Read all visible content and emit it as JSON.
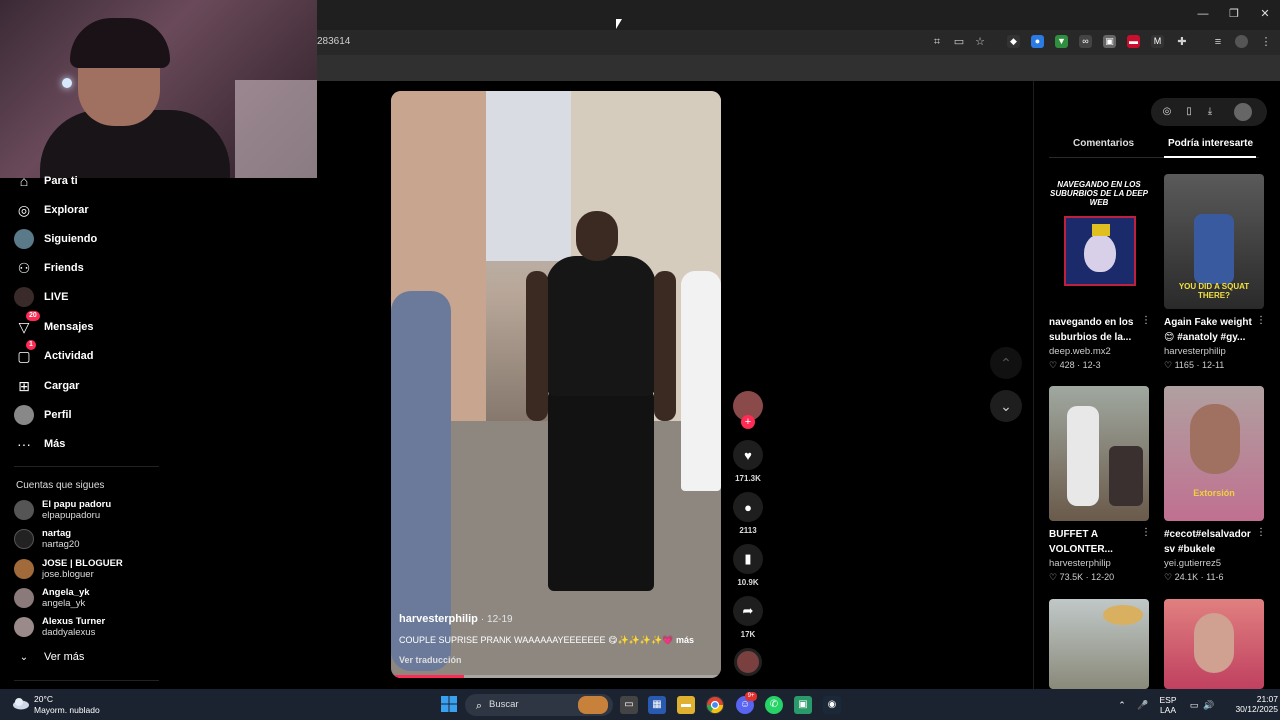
{
  "browser": {
    "url_fragment": "283614",
    "window_controls": [
      "—",
      "❐",
      "✕"
    ]
  },
  "sidebar": {
    "partial_item": "Para ti",
    "items": [
      {
        "label": "Explorar",
        "icon": "compass-icon"
      },
      {
        "label": "Siguiendo",
        "icon": "following-avatar-icon"
      },
      {
        "label": "Friends",
        "icon": "friends-icon"
      },
      {
        "label": "LIVE",
        "icon": "live-icon"
      },
      {
        "label": "Mensajes",
        "icon": "messages-icon",
        "badge": "20"
      },
      {
        "label": "Actividad",
        "icon": "activity-icon",
        "badge": "1"
      },
      {
        "label": "Cargar",
        "icon": "upload-icon"
      },
      {
        "label": "Perfil",
        "icon": "profile-avatar-icon"
      },
      {
        "label": "Más",
        "icon": "more-dots-icon"
      }
    ],
    "following_title": "Cuentas que sigues",
    "following": [
      {
        "name": "El papu padoru",
        "handle": "elpapupadoru"
      },
      {
        "name": "nartag",
        "handle": "nartag20"
      },
      {
        "name": "JOSE | BLOGUER",
        "handle": "jose.bloguer"
      },
      {
        "name": "Angela_yk",
        "handle": "angela_yk"
      },
      {
        "name": "Alexus Turner",
        "handle": "daddyalexus"
      }
    ],
    "see_more": "Ver más"
  },
  "video": {
    "author": "harvesterphilip",
    "date": "· 12-19",
    "description": "COUPLE SUPRISE PRANK WAAAAAAYEEEEEEE 😋✨✨✨✨💗",
    "more": "más",
    "translate": "Ver traducción",
    "progress": 0.22
  },
  "actions": {
    "likes": "171.3K",
    "comments": "2113",
    "saves": "10.9K",
    "shares": "17K"
  },
  "right_panel": {
    "tabs": [
      "Comentarios",
      "Podría interesarte"
    ],
    "active_tab": 1,
    "cards": [
      {
        "title": "navegando en los suburbios de la...",
        "author": "deep.web.mx2",
        "likes": "428",
        "date": "12-3",
        "thumb_text": "NAVEGANDO EN LOS SUBURBIOS DE LA DEEP WEB"
      },
      {
        "title": "Again Fake weight 😊 #anatoly #gy...",
        "author": "harvesterphilip",
        "likes": "1165",
        "date": "12-11",
        "thumb_text": "YOU DID A SQUAT THERE?"
      },
      {
        "title": "BUFFET A VOLONTER...",
        "author": "harvesterphilip",
        "likes": "73.5K",
        "date": "12-20",
        "thumb_text": ""
      },
      {
        "title": "#cecot#elsalvador sv #bukele",
        "author": "yei.gutierrez5",
        "likes": "24.1K",
        "date": "11-6",
        "thumb_text": "Extorsión"
      },
      {
        "title": "",
        "author": "",
        "likes": "",
        "date": "",
        "thumb_text": ""
      },
      {
        "title": "",
        "author": "",
        "likes": "",
        "date": "",
        "thumb_text": ""
      }
    ]
  },
  "taskbar": {
    "temperature": "20°C",
    "weather": "Mayorm. nublado",
    "search_placeholder": "Buscar",
    "lang_top": "ESP",
    "lang_bottom": "LAA",
    "time": "21:07",
    "date": "30/12/2025",
    "discord_badge": "9+"
  },
  "colors": {
    "accent": "#fe2c55",
    "background": "#000000",
    "taskbar": "#1c2330"
  }
}
